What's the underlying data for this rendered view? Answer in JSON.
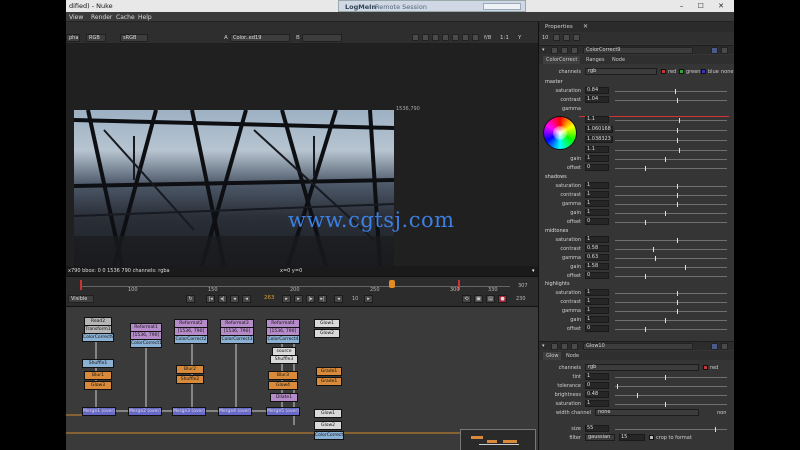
{
  "window": {
    "title": "dified) - Nuke",
    "logme_brand": "LogMeIn",
    "logme_session": "Remote Session",
    "controls": "– ☐ ✕"
  },
  "menus": [
    "View",
    "Render",
    "Cache",
    "Help"
  ],
  "viewer_toolbar": {
    "alpha": "pha",
    "rgb": "RGB",
    "srgb": "sRGB",
    "a_label": "A",
    "color_combo": "Color..ed19",
    "b_label": "B",
    "fstop": "f/8",
    "ratio": "1:1",
    "y_label": "Y",
    "view_mode": "2D"
  },
  "viewer": {
    "bbox_corner": "1536,790",
    "watermark": "www.cgtsj.com",
    "status_left": "x790  bbox: 0 0 1536 790 channels: rgba",
    "status_coords": "x=0 y=0"
  },
  "timeline": {
    "ticks": [
      "100",
      "150",
      "200",
      "250",
      "300"
    ],
    "end_left": "330",
    "end_right": "307",
    "visible_combo": "Visible",
    "current_frame": "263",
    "step": "10",
    "end_frame": "230"
  },
  "nodes": {
    "read": "Read2",
    "read_sub": "Transform1",
    "read_label": "ColorCorrect9",
    "reformat1": "Reformat1",
    "reformat1_sub": "[1536, 790]",
    "reformat2": "Reformat2",
    "reformat2_sub": "[1536, 790]",
    "reformat3": "Reformat3",
    "reformat3_sub": "[1536, 790]",
    "reformat4": "Reformat4",
    "reformat4_sub": "[1536, 790]",
    "cc_a": "ColorCorrect1",
    "cc_b": "ColorCorrect2",
    "cc_c": "ColorCorrect3",
    "cc_d": "ColorCorrect4",
    "shuffle1": "Shuffle1",
    "shuffle2": "Shuffle2",
    "shuffle3": "Shuffle3",
    "blur1": "Blur1",
    "blur2": "Blur2",
    "blur3": "Blur3",
    "glow1": "Glow1",
    "glow2": "Glow2",
    "glow3": "Glow3",
    "glow4": "Glow4",
    "source": "source",
    "dilate1": "Dilate1",
    "grade": "Grade1",
    "merge1": "Merge1 (over)",
    "merge2": "Merge2 (over)",
    "merge3": "Merge3 (over)",
    "merge4": "Merge4 (over)",
    "merge5": "Merge5 (over)",
    "final": "ColorCorrect5"
  },
  "properties": {
    "panel_title": "Properties",
    "max_count": "10",
    "node1": {
      "name": "ColorCorrect9",
      "tabs": [
        "ColorCorrect",
        "Ranges",
        "Node"
      ],
      "channels_label": "channels",
      "channels_value": "rgb",
      "channel_flags": [
        "red",
        "green",
        "blue"
      ],
      "channel_extra": "none",
      "sections": [
        {
          "name": "master",
          "rows": [
            {
              "label": "saturation",
              "value": "0.84"
            },
            {
              "label": "contrast",
              "value": "1.04"
            },
            {
              "label": "gamma",
              "value": ""
            },
            {
              "label": "",
              "value": "1.1"
            },
            {
              "label": "",
              "value": "1.060168"
            },
            {
              "label": "",
              "value": "1.038323"
            },
            {
              "label": "",
              "value": "1.1"
            },
            {
              "label": "gain",
              "value": "1"
            },
            {
              "label": "offset",
              "value": "0"
            }
          ]
        },
        {
          "name": "shadows",
          "rows": [
            {
              "label": "saturation",
              "value": "1"
            },
            {
              "label": "contrast",
              "value": "1"
            },
            {
              "label": "gamma",
              "value": "1"
            },
            {
              "label": "gain",
              "value": "1"
            },
            {
              "label": "offset",
              "value": "0"
            }
          ]
        },
        {
          "name": "midtones",
          "rows": [
            {
              "label": "saturation",
              "value": "1"
            },
            {
              "label": "contrast",
              "value": "0.58"
            },
            {
              "label": "gamma",
              "value": "0.63"
            },
            {
              "label": "gain",
              "value": "1.58"
            },
            {
              "label": "offset",
              "value": "0"
            }
          ]
        },
        {
          "name": "highlights",
          "rows": [
            {
              "label": "saturation",
              "value": "1"
            },
            {
              "label": "contrast",
              "value": "1"
            },
            {
              "label": "gamma",
              "value": "1"
            },
            {
              "label": "gain",
              "value": "1"
            },
            {
              "label": "offset",
              "value": "0"
            }
          ]
        }
      ]
    },
    "node2": {
      "name": "Glow10",
      "tabs": [
        "Glow",
        "Node"
      ],
      "channels_label": "channels",
      "channels_value": "rgb",
      "channel_flag": "red",
      "rows": [
        {
          "label": "tint",
          "value": "1"
        },
        {
          "label": "tolerance",
          "value": "0"
        },
        {
          "label": "brightness",
          "value": "0.48"
        },
        {
          "label": "saturation",
          "value": "1"
        }
      ],
      "width_channel_label": "width channel",
      "width_channel_value": "none",
      "width_channel_extra": "non",
      "size_label": "size",
      "size_value": "55",
      "filter_label": "filter",
      "filter_value": "gaussian",
      "filter_num": "15",
      "crop_label": "crop to format"
    }
  }
}
